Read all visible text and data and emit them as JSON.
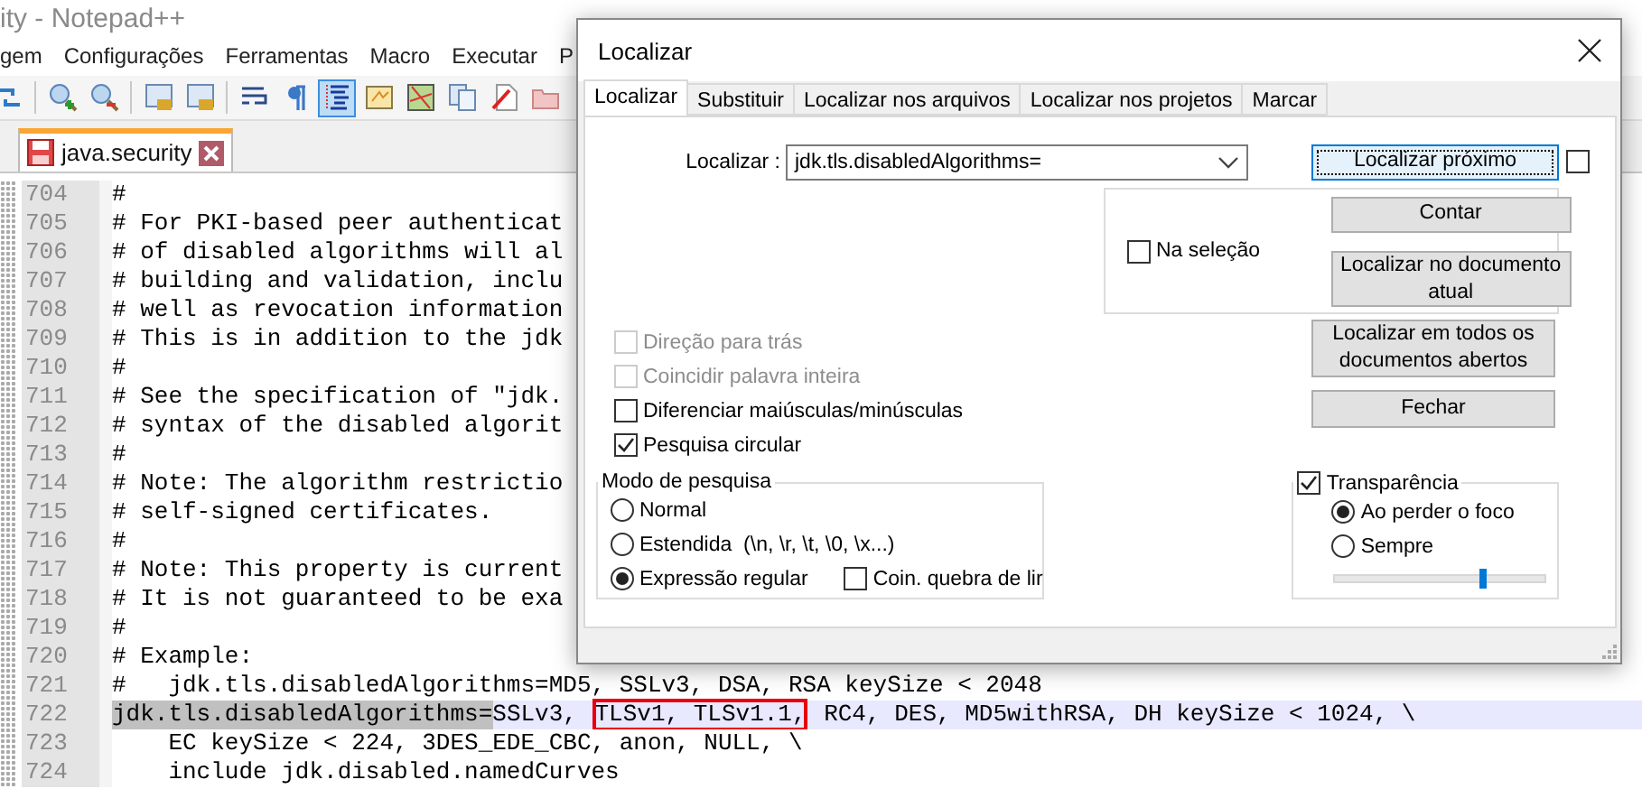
{
  "window": {
    "title": "ity - Notepad++"
  },
  "menu": [
    "gem",
    "Configurações",
    "Ferramentas",
    "Macro",
    "Executar",
    "P"
  ],
  "toolbar_groups": [
    {
      "buttons": [
        {
          "kind": "sync",
          "on": false
        }
      ]
    },
    {
      "buttons": [
        {
          "kind": "zoom-in",
          "on": false
        },
        {
          "kind": "zoom-out",
          "on": false
        }
      ]
    },
    {
      "buttons": [
        {
          "kind": "lock",
          "on": false
        },
        {
          "kind": "lock",
          "on": false
        }
      ]
    },
    {
      "buttons": [
        {
          "kind": "wrap",
          "on": false
        },
        {
          "kind": "pilcrow",
          "on": false
        },
        {
          "kind": "indent",
          "on": true
        },
        {
          "kind": "panel",
          "on": false
        },
        {
          "kind": "map",
          "on": false
        },
        {
          "kind": "documents",
          "on": false
        },
        {
          "kind": "pen",
          "on": false
        },
        {
          "kind": "folder",
          "on": false
        }
      ]
    }
  ],
  "file_tabs": [
    {
      "label": "java.security",
      "selected": true
    }
  ],
  "editor": {
    "lines": [
      {
        "number": "704",
        "current": false,
        "segments": [
          {
            "kind": "plain",
            "text": "#"
          }
        ]
      },
      {
        "number": "705",
        "current": false,
        "segments": [
          {
            "kind": "plain",
            "text": "# For PKI-based peer authenticat"
          }
        ]
      },
      {
        "number": "706",
        "current": false,
        "segments": [
          {
            "kind": "plain",
            "text": "# of disabled algorithms will al"
          }
        ]
      },
      {
        "number": "707",
        "current": false,
        "segments": [
          {
            "kind": "plain",
            "text": "# building and validation, inclu"
          }
        ]
      },
      {
        "number": "708",
        "current": false,
        "segments": [
          {
            "kind": "plain",
            "text": "# well as revocation information"
          }
        ]
      },
      {
        "number": "709",
        "current": false,
        "segments": [
          {
            "kind": "plain",
            "text": "# This is in addition to the jdk"
          }
        ]
      },
      {
        "number": "710",
        "current": false,
        "segments": [
          {
            "kind": "plain",
            "text": "#"
          }
        ]
      },
      {
        "number": "711",
        "current": false,
        "segments": [
          {
            "kind": "plain",
            "text": "# See the specification of \"jdk."
          }
        ]
      },
      {
        "number": "712",
        "current": false,
        "segments": [
          {
            "kind": "plain",
            "text": "# syntax of the disabled algorit"
          }
        ]
      },
      {
        "number": "713",
        "current": false,
        "segments": [
          {
            "kind": "plain",
            "text": "#"
          }
        ]
      },
      {
        "number": "714",
        "current": false,
        "segments": [
          {
            "kind": "plain",
            "text": "# Note: The algorithm restrictio"
          }
        ]
      },
      {
        "number": "715",
        "current": false,
        "segments": [
          {
            "kind": "plain",
            "text": "# self-signed certificates."
          }
        ]
      },
      {
        "number": "716",
        "current": false,
        "segments": [
          {
            "kind": "plain",
            "text": "#"
          }
        ]
      },
      {
        "number": "717",
        "current": false,
        "segments": [
          {
            "kind": "plain",
            "text": "# Note: This property is current"
          }
        ]
      },
      {
        "number": "718",
        "current": false,
        "segments": [
          {
            "kind": "plain",
            "text": "# It is not guaranteed to be exa"
          }
        ]
      },
      {
        "number": "719",
        "current": false,
        "segments": [
          {
            "kind": "plain",
            "text": "#"
          }
        ]
      },
      {
        "number": "720",
        "current": false,
        "segments": [
          {
            "kind": "plain",
            "text": "# Example:"
          }
        ]
      },
      {
        "number": "721",
        "current": false,
        "segments": [
          {
            "kind": "plain",
            "text": "#   jdk.tls.disabledAlgorithms=MD5, SSLv3, DSA, RSA keySize < 2048"
          }
        ]
      },
      {
        "number": "722",
        "current": true,
        "segments": [
          {
            "kind": "selected",
            "text": "jdk.tls.disabledAlgorithms="
          },
          {
            "kind": "plain",
            "text": "SSLv3, "
          },
          {
            "kind": "boxed",
            "text": "TLSv1, TLSv1.1,"
          },
          {
            "kind": "plain",
            "text": " RC4, DES, MD5withRSA, DH keySize < 1024, \\"
          }
        ]
      },
      {
        "number": "723",
        "current": false,
        "segments": [
          {
            "kind": "plain",
            "text": "    EC keySize < 224, 3DES_EDE_CBC, anon, NULL, \\"
          }
        ]
      },
      {
        "number": "724",
        "current": false,
        "segments": [
          {
            "kind": "plain",
            "text": "    include jdk.disabled.namedCurves"
          }
        ]
      }
    ]
  },
  "dialog": {
    "title": "Localizar",
    "tabs": [
      {
        "label": "Localizar",
        "selected": true
      },
      {
        "label": "Substituir",
        "selected": false
      },
      {
        "label": "Localizar nos arquivos",
        "selected": false
      },
      {
        "label": "Localizar nos projetos",
        "selected": false
      },
      {
        "label": "Marcar",
        "selected": false
      }
    ],
    "find_label": "Localizar :",
    "find_value": "jdk.tls.disabledAlgorithms=",
    "find_next": {
      "label": "Localizar próximo",
      "default": true
    },
    "find_next_option": {
      "checked": false
    },
    "in_selection": {
      "label": "Na seleção",
      "checked": false
    },
    "buttons": [
      "Contar",
      "Localizar no documento atual"
    ],
    "buttons_lower": [
      "Localizar em todos os documentos abertos",
      "Fechar"
    ],
    "options": [
      {
        "label": "Direção para trás",
        "checked": false,
        "disabled": true
      },
      {
        "label": "Coincidir palavra inteira",
        "checked": false,
        "disabled": true
      },
      {
        "label": "Diferenciar maiúsculas/minúsculas",
        "checked": false,
        "disabled": false
      },
      {
        "label": "Pesquisa circular",
        "checked": true,
        "disabled": false
      }
    ],
    "search_mode": {
      "title": "Modo de pesquisa",
      "options": [
        {
          "label": "Normal",
          "selected": false
        },
        {
          "label": "Estendida  (\\n, \\r, \\t, \\0, \\x...)",
          "selected": false
        },
        {
          "label": "Expressão regular",
          "selected": true
        }
      ],
      "newline_option": {
        "label": "Coin. quebra de lir",
        "checked": false
      }
    },
    "transparency": {
      "label": "Transparência",
      "checked": true,
      "options": [
        {
          "label": "Ao perder o foco",
          "selected": true
        },
        {
          "label": "Sempre",
          "selected": false
        }
      ],
      "level": 0.7
    }
  }
}
